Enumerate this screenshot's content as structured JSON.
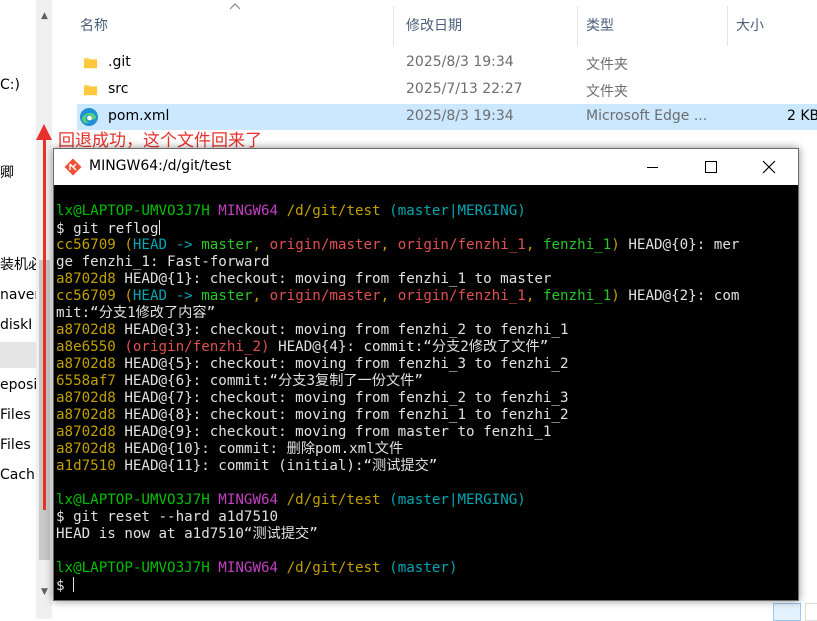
{
  "nav_pane": {
    "items": [
      "C:)",
      "",
      "卿",
      "",
      "装机必",
      "naver",
      "diskI",
      "",
      "eposi",
      "Files",
      "Files",
      "Cach"
    ]
  },
  "file_list": {
    "columns": {
      "name": "名称",
      "date": "修改日期",
      "type": "类型",
      "size": "大小"
    },
    "rows": [
      {
        "name": ".git",
        "date": "2025/8/3 19:34",
        "type": "文件夹",
        "size": "",
        "icon": "folder-icon"
      },
      {
        "name": "src",
        "date": "2025/7/13 22:27",
        "type": "文件夹",
        "size": "",
        "icon": "folder-icon"
      },
      {
        "name": "pom.xml",
        "date": "2025/8/3 19:34",
        "type": "Microsoft Edge ...",
        "size": "2 KB",
        "icon": "edge-icon"
      }
    ]
  },
  "annotation": {
    "text": "回退成功，这个文件回来了",
    "color": "#e8312c"
  },
  "terminal": {
    "title": "MINGW64:/d/git/test",
    "prompt_user": "lx@LAPTOP-UMVO3J7H",
    "prompt_shell": "MINGW64",
    "prompt_path": "/d/git/test",
    "branch_merging": "(master|MERGING)",
    "branch_master": "(master)",
    "cmd1": "$ git reflog",
    "reflog": {
      "l1_hash": "cc56709",
      "l1_open": "(",
      "l1_head": "HEAD ->",
      "l1_master": "master",
      "l1_c1": ",",
      "l1_origin_master": "origin/master",
      "l1_c2": ",",
      "l1_origin_fenzhi": "origin/fenzhi_1",
      "l1_c3": ",",
      "l1_fenzhi": "fenzhi_1",
      "l1_close": ")",
      "l1_rest": " HEAD@{0}: mer",
      "l1_wrap": "ge fenzhi_1: Fast-forward",
      "l2_hash": "a8702d8",
      "l2_rest": " HEAD@{1}: checkout: moving from fenzhi_1 to master",
      "l3_hash": "cc56709",
      "l3_rest": " HEAD@{2}: com",
      "l3_wrap": "mit:“分支1修改了内容”",
      "l4_hash": "a8702d8",
      "l4_rest": " HEAD@{3}: checkout: moving from fenzhi_2 to fenzhi_1",
      "l5_hash": "a8e6550",
      "l5_ref": "(origin/fenzhi_2)",
      "l5_rest": " HEAD@{4}: commit:“分支2修改了文件”",
      "l6_hash": "a8702d8",
      "l6_rest": " HEAD@{5}: checkout: moving from fenzhi_3 to fenzhi_2",
      "l7_hash": "6558af7",
      "l7_rest": " HEAD@{6}: commit:“分支3复制了一份文件”",
      "l8_hash": "a8702d8",
      "l8_rest": " HEAD@{7}: checkout: moving from fenzhi_2 to fenzhi_3",
      "l9_hash": "a8702d8",
      "l9_rest": " HEAD@{8}: checkout: moving from fenzhi_1 to fenzhi_2",
      "l10_hash": "a8702d8",
      "l10_rest": " HEAD@{9}: checkout: moving from master to fenzhi_1",
      "l11_hash": "a8702d8",
      "l11_rest": " HEAD@{10}: commit: 删除pom.xml文件",
      "l12_hash": "a1d7510",
      "l12_rest": " HEAD@{11}: commit (initial):“测试提交”"
    },
    "cmd2": "$ git reset --hard a1d7510",
    "output2": "HEAD is now at a1d7510“测试提交”",
    "final_prompt": "$ "
  }
}
